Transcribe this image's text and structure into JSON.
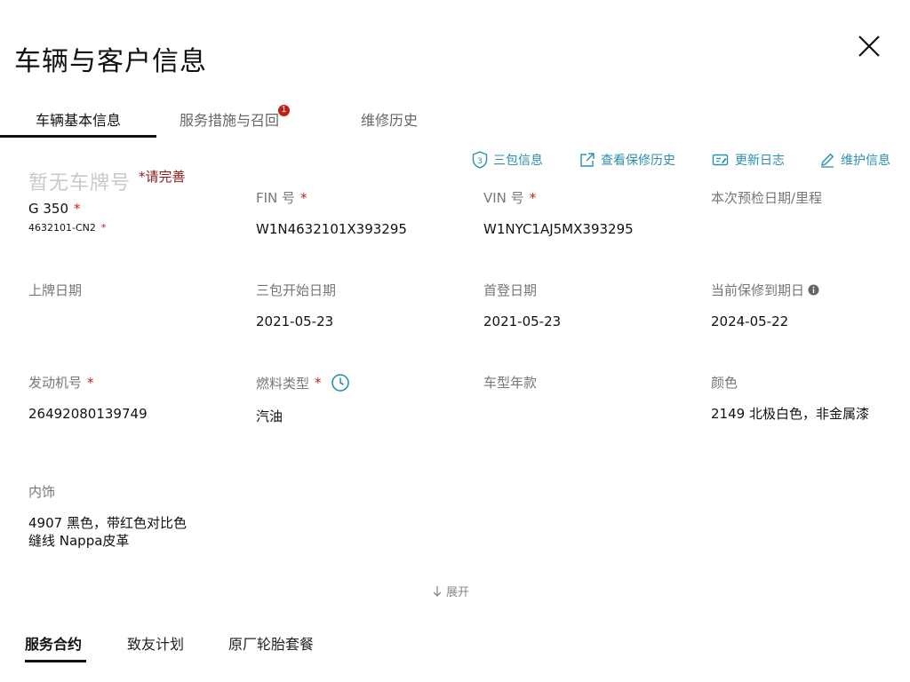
{
  "header": {
    "title": "车辆与客户信息"
  },
  "tabs": [
    {
      "label": "车辆基本信息",
      "badge": ""
    },
    {
      "label": "服务措施与召回",
      "badge": "1"
    },
    {
      "label": "维修历史",
      "badge": ""
    }
  ],
  "actions": {
    "warranty": "三包信息",
    "history": "查看保修历史",
    "log": "更新日志",
    "maintain": "维护信息",
    "warranty_icon_text": "3"
  },
  "vehicle": {
    "plate_placeholder": "暂无车牌号",
    "plate_required": "*请完善",
    "model": "G 350",
    "code": "4632101-CN2"
  },
  "fields": {
    "fin": {
      "label": "FIN 号",
      "value": "W1N4632101X393295"
    },
    "vin": {
      "label": "VIN 号",
      "value": "W1NYC1AJ5MX393295"
    },
    "inspection": {
      "label": "本次预检日期/里程",
      "value": ""
    },
    "reg_date": {
      "label": "上牌日期",
      "value": ""
    },
    "warranty_start": {
      "label": "三包开始日期",
      "value": "2021-05-23"
    },
    "first_reg": {
      "label": "首登日期",
      "value": "2021-05-23"
    },
    "warranty_end": {
      "label": "当前保修到期日",
      "value": "2024-05-22"
    },
    "engine": {
      "label": "发动机号",
      "value": "26492080139749"
    },
    "fuel": {
      "label": "燃料类型",
      "value": "汽油"
    },
    "model_year": {
      "label": "车型年款",
      "value": ""
    },
    "color": {
      "label": "颜色",
      "value": "2149 北极白色，非金属漆"
    },
    "interior": {
      "label": "内饰",
      "value": "4907 黑色，带红色对比色缝线 Nappa皮革"
    }
  },
  "required_mark": "*",
  "expand_label": "展开",
  "bottom_tabs": [
    "服务合约",
    "致友计划",
    "原厂轮胎套餐"
  ],
  "colors": {
    "accent": "#2b8fb1",
    "required": "#c0201c",
    "badge": "#c0201c",
    "placeholder": "#c9c9c9"
  }
}
